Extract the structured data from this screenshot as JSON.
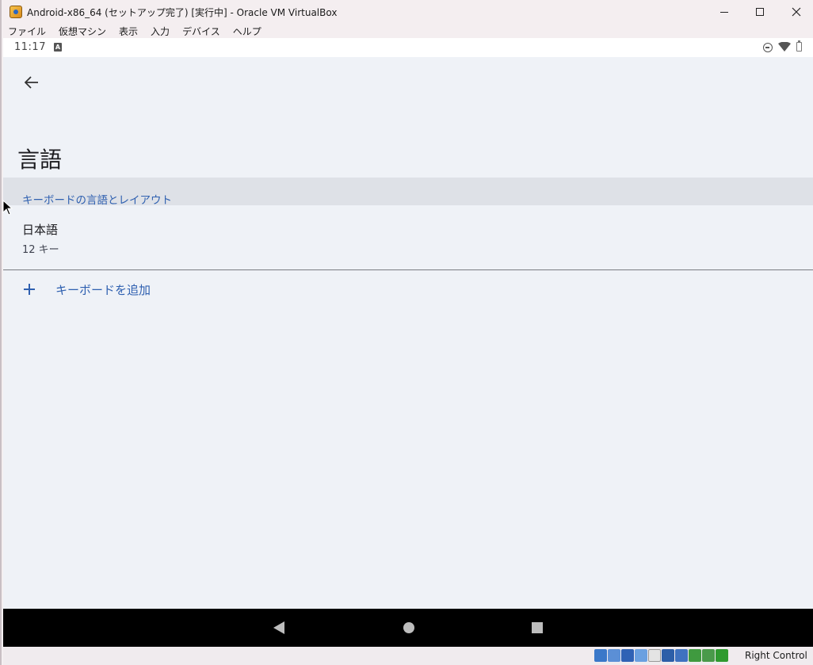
{
  "window": {
    "title": "Android-x86_64 (セットアップ完了) [実行中] - Oracle VM VirtualBox",
    "minimize_icon": "minimize-icon",
    "maximize_icon": "maximize-icon",
    "close_icon": "close-icon"
  },
  "menubar": {
    "items": [
      "ファイル",
      "仮想マシン",
      "表示",
      "入力",
      "デバイス",
      "ヘルプ"
    ]
  },
  "android": {
    "statusbar": {
      "time": "11:17",
      "notification_icon": "A"
    },
    "page_title": "言語",
    "section_label": "キーボードの言語とレイアウト",
    "language": {
      "name": "日本語",
      "layout": "12 キー"
    },
    "add_keyboard_label": "キーボードを追加"
  },
  "vbox_status": {
    "host_key": "Right Control"
  },
  "colors": {
    "accent": "#2f60b0",
    "screen_bg": "#eff2f7",
    "section_bg": "#dee1e7"
  }
}
